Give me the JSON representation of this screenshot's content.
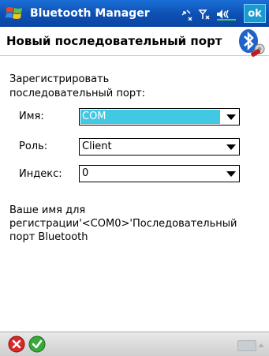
{
  "titlebar": {
    "app_title": "Bluetooth Manager",
    "tray_icons": [
      "connectivity-icon",
      "signal-off-icon",
      "volume-icon"
    ],
    "ok_label": "ok"
  },
  "header": {
    "title": "Новый последовательный порт"
  },
  "form": {
    "intro_line1": "Зарегистрировать",
    "intro_line2": "последовательный порт:",
    "name_label": "Имя:",
    "name_value": "COM",
    "role_label": "Роль:",
    "role_value": "Client",
    "index_label": "Индекс:",
    "index_value": "0"
  },
  "info": {
    "line1": "Ваше имя для",
    "line2": "регистрации'<COM0>'Последовательный",
    "line3": "порт Bluetooth"
  },
  "colors": {
    "titlebar": "#0d4fb2",
    "selection": "#41c8e2",
    "cancel": "#d42a2a",
    "ok": "#3aa83a"
  }
}
